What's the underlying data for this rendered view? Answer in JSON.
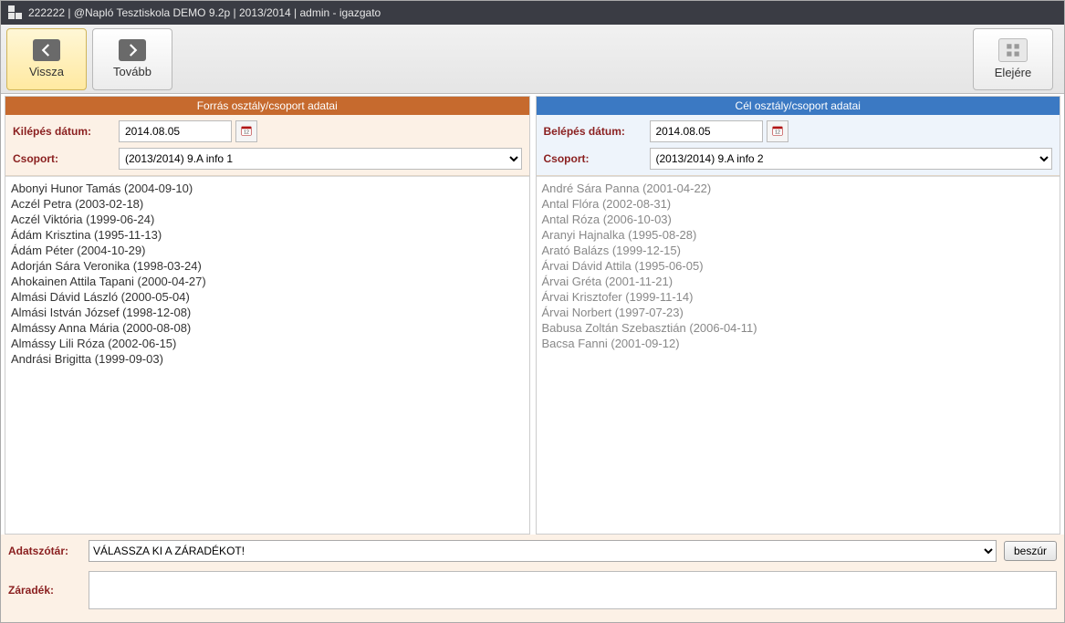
{
  "topbar": {
    "text": "222222 | @Napló Tesztiskola DEMO 9.2p | 2013/2014 |  admin - igazgato"
  },
  "toolbar": {
    "back_label": "Vissza",
    "forward_label": "Tovább",
    "top_label": "Elejére"
  },
  "source": {
    "header": "Forrás osztály/csoport adatai",
    "date_label": "Kilépés dátum:",
    "date_value": "2014.08.05",
    "group_label": "Csoport:",
    "group_value": "(2013/2014) 9.A info 1",
    "students": [
      "Abonyi Hunor Tamás (2004-09-10)",
      "Aczél Petra (2003-02-18)",
      "Aczél Viktória (1999-06-24)",
      "Ádám Krisztina (1995-11-13)",
      "Ádám Péter (2004-10-29)",
      "Adorján Sára Veronika (1998-03-24)",
      "Ahokainen Attila Tapani (2000-04-27)",
      "Almási Dávid László (2000-05-04)",
      "Almási István József (1998-12-08)",
      "Almássy Anna Mária (2000-08-08)",
      "Almássy Lili Róza (2002-06-15)",
      "Andrási Brigitta (1999-09-03)"
    ]
  },
  "target": {
    "header": "Cél osztály/csoport adatai",
    "date_label": "Belépés dátum:",
    "date_value": "2014.08.05",
    "group_label": "Csoport:",
    "group_value": "(2013/2014) 9.A info 2",
    "students": [
      "André Sára Panna (2001-04-22)",
      "Antal Flóra (2002-08-31)",
      "Antal Róza (2006-10-03)",
      "Aranyi Hajnalka (1995-08-28)",
      "Arató Balázs (1999-12-15)",
      "Árvai Dávid Attila (1995-06-05)",
      "Árvai Gréta (2001-11-21)",
      "Árvai Krisztofer (1999-11-14)",
      "Árvai Norbert (1997-07-23)",
      "Babusa Zoltán Szebasztián (2006-04-11)",
      "Bacsa Fanni (2001-09-12)"
    ]
  },
  "dict": {
    "label": "Adatszótár:",
    "selected": "VÁLASSZA KI A ZÁRADÉKOT!",
    "insert_label": "beszúr"
  },
  "clause": {
    "label": "Záradék:",
    "value": ""
  }
}
